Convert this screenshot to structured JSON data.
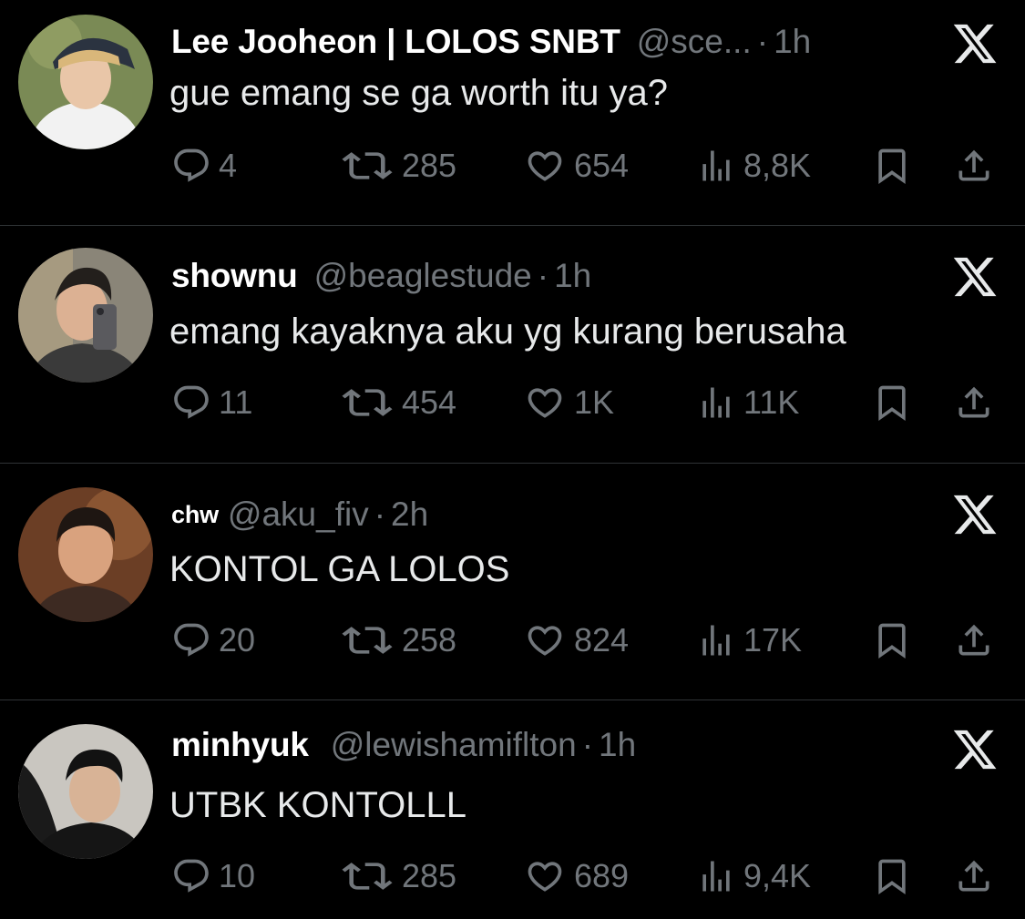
{
  "colors": {
    "background": "#000000",
    "text_primary": "#e7e9ea",
    "text_secondary": "#71767b",
    "divider": "#2f3336"
  },
  "tweets": [
    {
      "display_name": "Lee Jooheon | LOLOS SNBT",
      "handle": "@sce...",
      "separator": "·",
      "time": "1h",
      "text": "gue emang se ga worth itu ya?",
      "replies": "4",
      "reposts": "285",
      "likes": "654",
      "views": "8,8K",
      "avatar_icon": "avatar-photo"
    },
    {
      "display_name": "shownu",
      "handle": "@beaglestude",
      "separator": "·",
      "time": "1h",
      "text": "emang kayaknya aku yg kurang berusaha",
      "replies": "11",
      "reposts": "454",
      "likes": "1K",
      "views": "11K",
      "avatar_icon": "avatar-photo"
    },
    {
      "display_name": "chw",
      "handle": "@aku_fiv",
      "separator": "·",
      "time": "2h",
      "text": "KONTOL GA LOLOS",
      "replies": "20",
      "reposts": "258",
      "likes": "824",
      "views": "17K",
      "avatar_icon": "avatar-photo"
    },
    {
      "display_name": "minhyuk",
      "handle": "@lewishamiflton",
      "separator": "·",
      "time": "1h",
      "text": "UTBK KONTOLLL",
      "replies": "10",
      "reposts": "285",
      "likes": "689",
      "views": "9,4K",
      "avatar_icon": "avatar-photo"
    }
  ],
  "icons": {
    "reply": "reply-icon",
    "repost": "repost-icon",
    "like": "like-icon",
    "views": "views-icon",
    "bookmark": "bookmark-icon",
    "share": "share-icon",
    "brand": "x-logo-icon"
  }
}
